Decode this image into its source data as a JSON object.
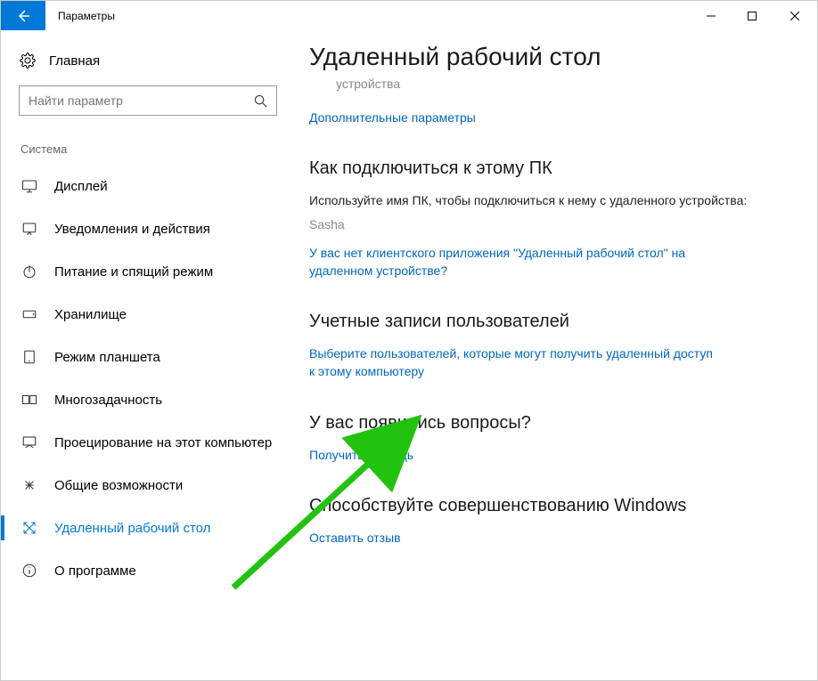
{
  "titlebar": {
    "title": "Параметры"
  },
  "sidebar": {
    "home": "Главная",
    "search_placeholder": "Найти параметр",
    "category": "Система",
    "items": [
      {
        "label": "Дисплей"
      },
      {
        "label": "Уведомления и действия"
      },
      {
        "label": "Питание и спящий режим"
      },
      {
        "label": "Хранилище"
      },
      {
        "label": "Режим планшета"
      },
      {
        "label": "Многозадачность"
      },
      {
        "label": "Проецирование на этот компьютер"
      },
      {
        "label": "Общие возможности"
      },
      {
        "label": "Удаленный рабочий стол"
      },
      {
        "label": "О программе"
      }
    ]
  },
  "content": {
    "page_title": "Удаленный рабочий стол",
    "device_sub": "устройства",
    "adv_link": "Дополнительные параметры",
    "how_h": "Как подключиться к этому ПК",
    "how_text": "Используйте имя ПК, чтобы подключиться к нему с удаленного устройства:",
    "pc_name": "Sasha",
    "noclient_link": "У вас нет клиентского приложения \"Удаленный рабочий стол\" на удаленном устройстве?",
    "accounts_h": "Учетные записи пользователей",
    "select_users_link": "Выберите пользователей, которые могут получить удаленный доступ к этому компьютеру",
    "questions_h": "У вас появились вопросы?",
    "help_link": "Получить помощь",
    "improve_h": "Способствуйте совершенствованию Windows",
    "feedback_link": "Оставить отзыв"
  }
}
